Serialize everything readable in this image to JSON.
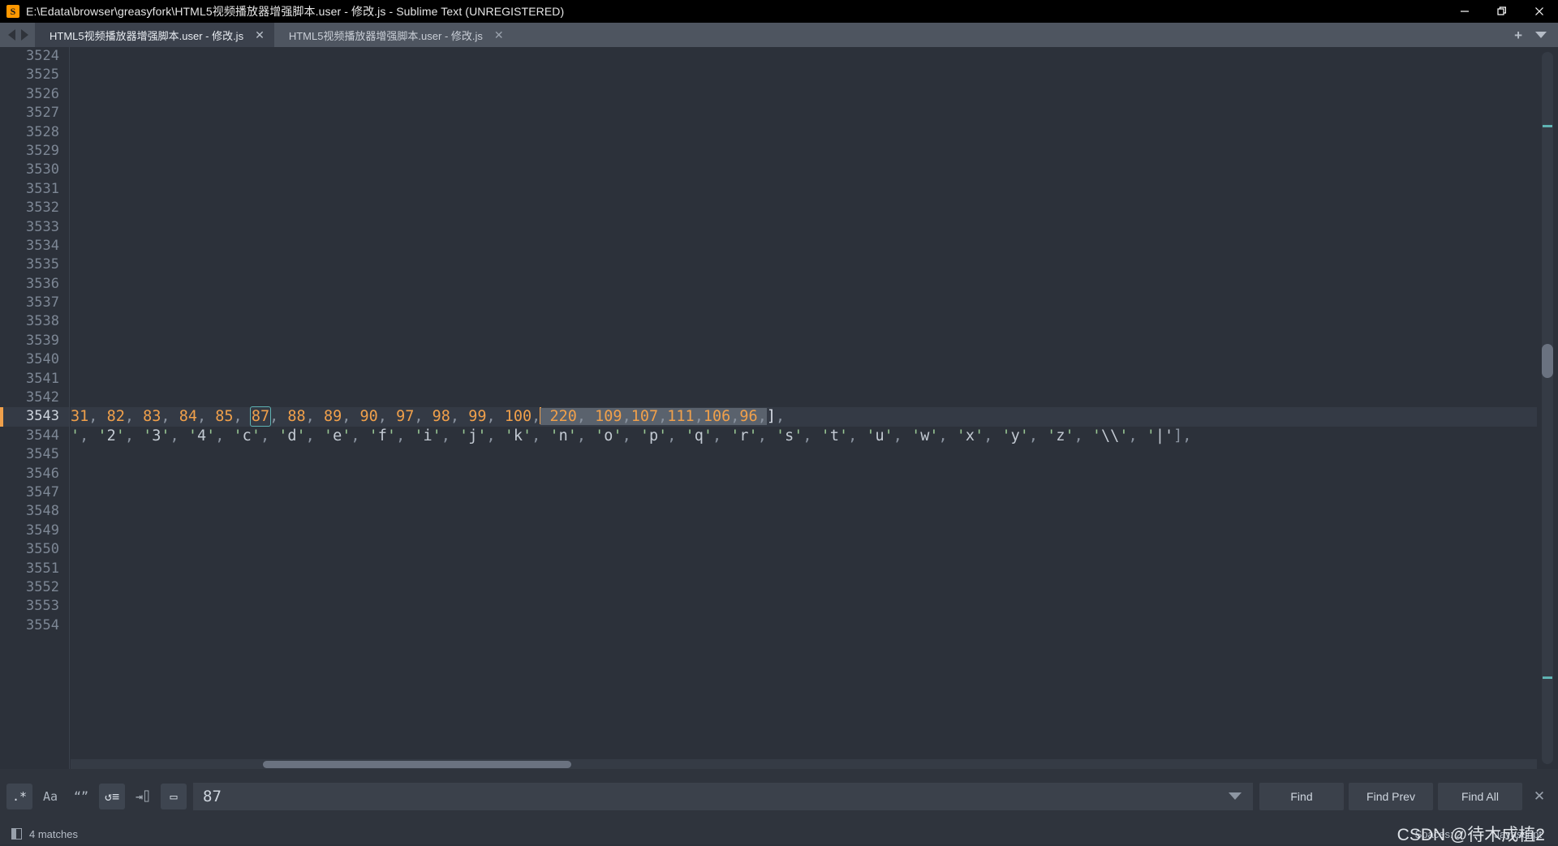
{
  "window": {
    "title": "E:\\Edata\\browser\\greasyfork\\HTML5视频播放器增强脚本.user - 修改.js - Sublime Text (UNREGISTERED)",
    "app_icon": "sublime-text-icon",
    "minimize_label": "—",
    "restore_label": "❐",
    "close_label": "✕"
  },
  "tabs": {
    "nav_prev": "prev-tab-arrow",
    "nav_next": "next-tab-arrow",
    "items": [
      {
        "label": "HTML5视频播放器增强脚本.user - 修改.js",
        "active": true,
        "close": "✕"
      },
      {
        "label": "HTML5视频播放器增强脚本.user - 修改.js",
        "active": false,
        "close": "✕"
      }
    ],
    "new_tab": "+",
    "tab_menu": "chevron-down-icon"
  },
  "editor": {
    "first_line": 3524,
    "last_line": 3554,
    "active_line": 3543,
    "gutter_lines": [
      "3524",
      "3525",
      "3526",
      "3527",
      "3528",
      "3529",
      "3530",
      "3531",
      "3532",
      "3533",
      "3534",
      "3535",
      "3536",
      "3537",
      "3538",
      "3539",
      "3540",
      "3541",
      "3542",
      "3543",
      "3544",
      "3545",
      "3546",
      "3547",
      "3548",
      "3549",
      "3550",
      "3551",
      "3552",
      "3553",
      "3554"
    ],
    "line_3543": {
      "prefix": "31, 82, 83, 84, 85, ",
      "match": "87",
      "middle": ", 88, 89, 90, 97, 98, 99, 100,",
      "selection": " 220, 109,107,111,106,96,",
      "suffix": "],"
    },
    "line_3544": {
      "text": "', '2', '3', '4', 'c', 'd', 'e', 'f', 'i', 'j', 'k', 'n', 'o', 'p', 'q', 'r', 's', 't', 'u', 'w', 'x', 'y', 'z', '\\\\', '|'],"
    }
  },
  "find_panel": {
    "toggles": [
      {
        "name": "regex-toggle",
        "glyph": ".*",
        "active": true
      },
      {
        "name": "case-sensitive-toggle",
        "glyph": "Aa",
        "active": false
      },
      {
        "name": "whole-word-toggle",
        "glyph": "“”",
        "active": false
      },
      {
        "name": "wrap-toggle",
        "glyph": "↺≡",
        "active": true
      },
      {
        "name": "in-selection-toggle",
        "glyph": "⇥⌷",
        "active": false
      },
      {
        "name": "highlight-toggle",
        "glyph": "▭",
        "active": true
      }
    ],
    "query": "87",
    "query_placeholder": "Find",
    "history_caret": "chevron-down-icon",
    "buttons": [
      {
        "name": "find-button",
        "label": "Find"
      },
      {
        "name": "find-prev-button",
        "label": "Find Prev"
      },
      {
        "name": "find-all-button",
        "label": "Find All"
      }
    ],
    "close": "✕"
  },
  "status_bar": {
    "panel_icon": "sidebar-toggle-icon",
    "matches": "4 matches",
    "spaces": "Spaces: 2",
    "syntax": "Javascript",
    "watermark": "CSDN @待木成植2"
  },
  "colors": {
    "accent_orange": "#f0a04b",
    "match_outline": "#5fb3b3",
    "string_green": "#99c794",
    "editor_bg": "#2c313a",
    "chrome_bg": "#2f343d",
    "tabbar_bg": "#4e5560"
  }
}
